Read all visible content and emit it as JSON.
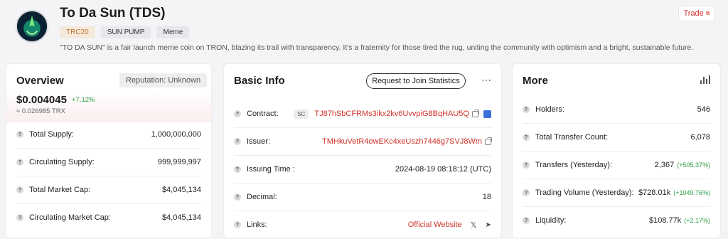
{
  "token": {
    "title": "To Da Sun (TDS)",
    "tags": [
      "TRC20",
      "SUN PUMP",
      "Meme"
    ],
    "description": "\"TO DA SUN\" is a fair launch meme coin on TRON, blazing its trail with transparency. It's a fraternity for those tired the rug, uniting the community with optimism and a bright, sustainable future."
  },
  "trade_button": {
    "label": "Trade"
  },
  "overview": {
    "title": "Overview",
    "reputation": "Reputation: Unknown",
    "price": "$0.004045",
    "change": "+7.12%",
    "trx_price": "≈ 0.026985 TRX",
    "rows": [
      {
        "label": "Total Supply:",
        "value": "1,000,000,000"
      },
      {
        "label": "Circulating Supply:",
        "value": "999,999,997"
      },
      {
        "label": "Total Market Cap:",
        "value": "$4,045,134"
      },
      {
        "label": "Circulating Market Cap:",
        "value": "$4,045,134"
      }
    ]
  },
  "basic_info": {
    "title": "Basic Info",
    "join_button": "Request to Join Statistics",
    "rows": [
      {
        "label": "Contract:",
        "badge": "SC",
        "value": "TJ87hSbCFRMs3ikx2kv6UvvpiG8BqHAU5Q"
      },
      {
        "label": "Issuer:",
        "value": "TMHkuVetR4owEKc4xeUszh7446g7SVJ8Wm"
      },
      {
        "label": "Issuing Time :",
        "value": "2024-08-19 08:18:12 (UTC)"
      },
      {
        "label": "Decimal:",
        "value": "18"
      },
      {
        "label": "Links:",
        "value": "Official Website"
      }
    ]
  },
  "more": {
    "title": "More",
    "rows": [
      {
        "label": "Holders:",
        "value": "546",
        "change": ""
      },
      {
        "label": "Total Transfer Count:",
        "value": "6,078",
        "change": ""
      },
      {
        "label": "Transfers (Yesterday):",
        "value": "2,367",
        "change": "(+505.37%)"
      },
      {
        "label": "Trading Volume (Yesterday):",
        "value": "$728.01k",
        "change": "(+1049.76%)"
      },
      {
        "label": "Liquidity:",
        "value": "$108.77k",
        "change": "(+2.17%)"
      }
    ]
  },
  "colors": {
    "accent_red": "#d0322a",
    "positive_green": "#2e9d47"
  }
}
